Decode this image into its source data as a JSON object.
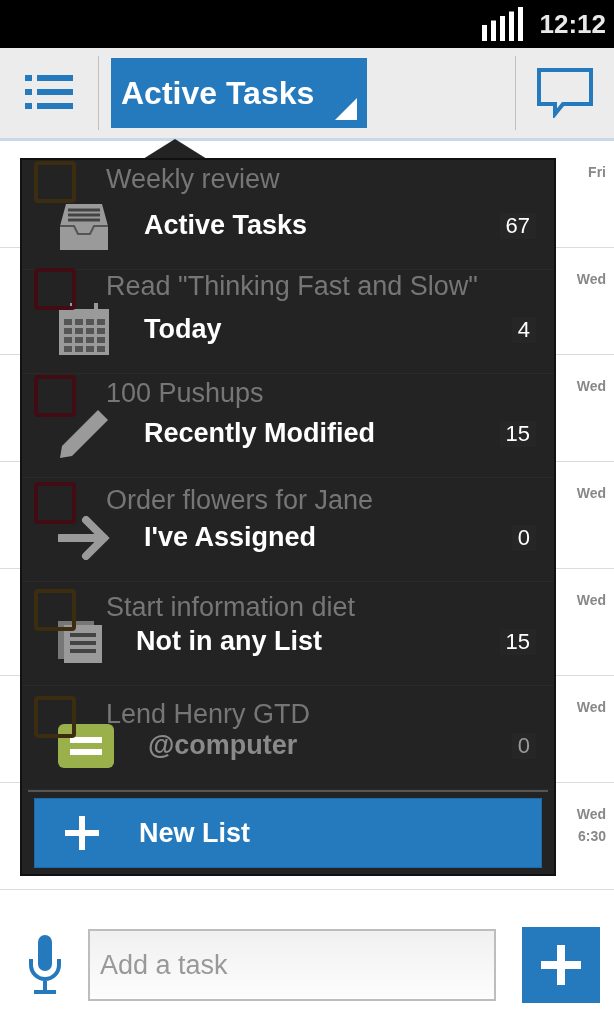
{
  "status_bar": {
    "time": "12:12"
  },
  "toolbar": {
    "list_title": "Active Tasks"
  },
  "tasks": [
    {
      "title": "Weekly review",
      "date": "Fri",
      "color": "#3c2c10"
    },
    {
      "title": "Read \"Thinking Fast and Slow\"",
      "date": "Wed",
      "color": "#420c14"
    },
    {
      "title": "100 Pushups",
      "date": "Wed",
      "color": "#420c14"
    },
    {
      "title": "Order flowers for Jane",
      "date": "Wed",
      "color": "#420c14"
    },
    {
      "title": "Start information diet",
      "date": "Wed",
      "color": "#3c2c10"
    },
    {
      "title": "Lend Henry GTD",
      "date": "Wed",
      "color": "#3c2c10"
    },
    {
      "date": "Wed",
      "time": "6:30"
    }
  ],
  "menu": {
    "items": [
      {
        "kind": "inbox",
        "label": "Active Tasks",
        "count": "67",
        "faded": false
      },
      {
        "kind": "calendar",
        "label": "Today",
        "count": "4",
        "faded": false
      },
      {
        "kind": "pencil",
        "label": "Recently Modified",
        "count": "15",
        "faded": false
      },
      {
        "kind": "arrow",
        "label": "I've Assigned",
        "count": "0",
        "faded": false
      },
      {
        "kind": "documents",
        "label": "Not in any List",
        "count": "15",
        "faded": false
      },
      {
        "kind": "list",
        "label": "@computer",
        "count": "0",
        "faded": true
      }
    ],
    "new_list_button": "New List"
  },
  "add_task": {
    "placeholder": "Add a task"
  }
}
